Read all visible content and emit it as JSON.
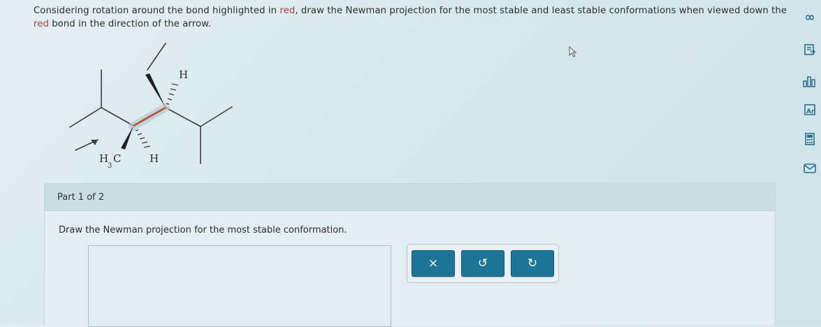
{
  "question": {
    "part_a": "Considering rotation around the bond highlighted in ",
    "red_word": "red",
    "part_b": ", draw the Newman projection for the most stable and least stable conformations when viewed down the ",
    "red_word_2": "red",
    "part_c": " bond in the direction of the arrow."
  },
  "molecule": {
    "label_h_top": "H",
    "label_h_bottom": "H",
    "label_h3c_h": "H",
    "label_h3c_sub": "3",
    "label_h3c_c": "C",
    "highlight_color": "#b84a3c"
  },
  "part": {
    "header": "Part 1 of 2",
    "instruction": "Draw the Newman projection for the most stable conformation."
  },
  "toolbar": {
    "clear_icon": "×",
    "undo_icon": "↺",
    "redo_icon": "↻"
  },
  "side_tools": [
    "infinity-icon",
    "explanation-icon",
    "chart-icon",
    "periodic-table-icon",
    "calculator-icon",
    "mail-icon"
  ],
  "colors": {
    "button": "#1f7598",
    "accent_red": "#b0403a"
  }
}
